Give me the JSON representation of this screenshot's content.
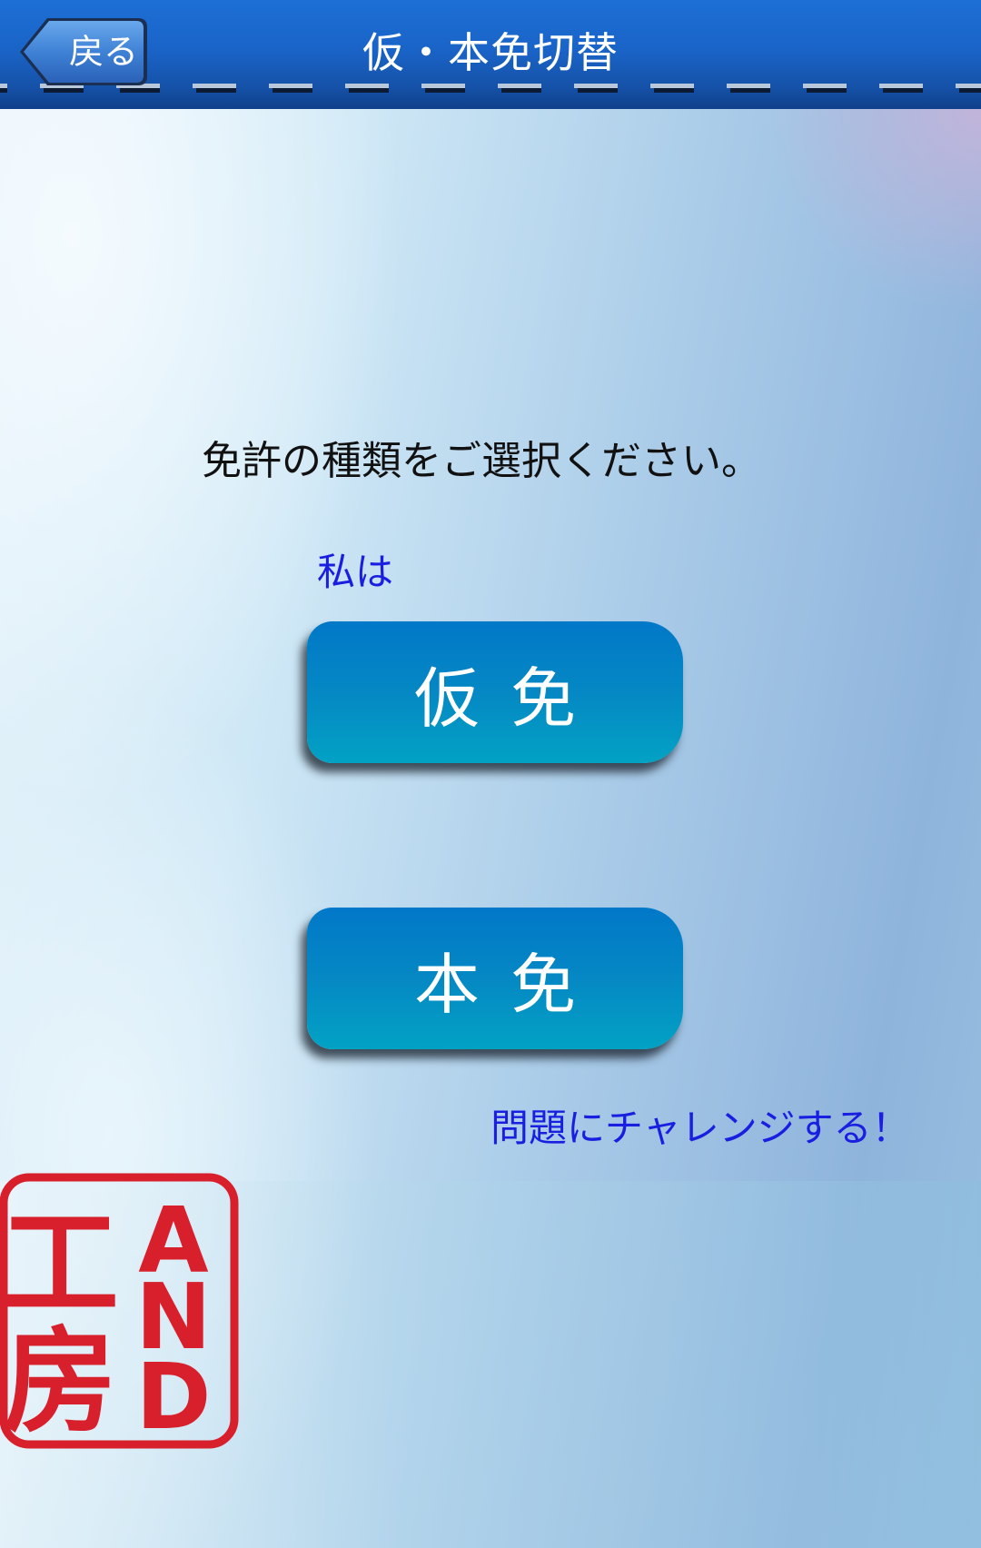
{
  "header": {
    "back_label": "戻る",
    "title": "仮・本免切替"
  },
  "main": {
    "prompt": "免許の種類をご選択ください。",
    "subject_label": "私は",
    "options": [
      {
        "label": "仮免"
      },
      {
        "label": "本免"
      }
    ],
    "challenge_label": "問題にチャレンジする！"
  },
  "logo": {
    "left_chars": [
      "工",
      "房"
    ],
    "right_chars": [
      "A",
      "N",
      "D"
    ],
    "color": "#d8202c"
  },
  "colors": {
    "header_blue": "#1a64c8",
    "button_top": "#0178c8",
    "button_bottom": "#02a2c4",
    "accent_text": "#1a1ee0"
  }
}
